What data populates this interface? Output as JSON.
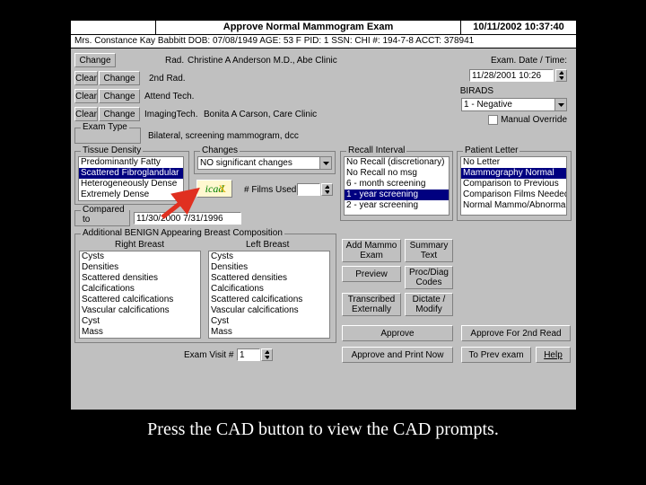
{
  "titlebar": {
    "left_blank": "",
    "title": "Approve Normal Mammogram Exam",
    "datetime": "10/11/2002 10:37:40"
  },
  "patient_line": "Mrs. Constance Kay Babbitt   DOB: 07/08/1949   AGE: 53   F   PID: 1   SSN:    CHI #: 194-7-8   ACCT: 378941",
  "buttons": {
    "change": "Change",
    "clear": "Clear",
    "add_mammo_exam": "Add Mammo Exam",
    "summary_text": "Summary Text",
    "preview": "Preview",
    "proc_diag": "Proc/Diag Codes",
    "transcribed": "Transcribed Externally",
    "dictate": "Dictate / Modify",
    "approve": "Approve",
    "approve_2nd": "Approve For 2nd Read",
    "approve_print": "Approve and Print Now",
    "to_prev": "To  Prev exam",
    "help": "Help",
    "icad": "icad"
  },
  "labels": {
    "rad": "Rad.",
    "rad_val": "Christine A Anderson M.D., Abe Clinic",
    "second_rad": "2nd Rad.",
    "attend_tech": "Attend Tech.",
    "imaging_tech": "ImagingTech.",
    "imaging_tech_val": "Bonita A Carson, Care Clinic",
    "exam_type": "Exam Type",
    "exam_type_val": "Bilateral, screening mammogram, dcc",
    "exam_datetime": "Exam. Date / Time:",
    "exam_datetime_val": "11/28/2001 10:26",
    "birads": "BIRADS",
    "birads_val": "1 - Negative",
    "manual_override": "Manual Override",
    "tissue_density": "Tissue Density",
    "changes_group": "Changes",
    "changes_val": "NO significant changes",
    "films_used": "# Films Used",
    "recall_interval": "Recall Interval",
    "patient_letter": "Patient Letter",
    "compared_to": "Compared to",
    "compared_val": "11/30/2000  7/31/1996",
    "benign_group": "Additional BENIGN Appearing Breast Composition",
    "right_breast": "Right Breast",
    "left_breast": "Left Breast",
    "exam_visit": "Exam Visit #",
    "exam_visit_val": "1"
  },
  "tissue_density": [
    "Predominantly Fatty",
    "Scattered Fibroglandular",
    "Heterogeneously Dense",
    "Extremely Dense"
  ],
  "tissue_density_selected": 1,
  "recall_interval": [
    "No Recall (discretionary)",
    "No Recall no msg",
    "6 - month screening",
    "1 - year screening",
    "2 - year screening"
  ],
  "recall_selected": 3,
  "patient_letter": [
    "No Letter",
    "Mammography Normal",
    "Comparison to Previous",
    "Comparison Films Needed",
    "Normal Mammo/Abnormal"
  ],
  "patient_letter_selected": 1,
  "right_breast_items": [
    "Cysts",
    "Densities",
    "Scattered densities",
    "Calcifications",
    "Scattered calcifications",
    "Vascular calcifications",
    "Cyst",
    "Mass"
  ],
  "left_breast_items": [
    "Cysts",
    "Densities",
    "Scattered densities",
    "Calcifications",
    "Scattered calcifications",
    "Vascular calcifications",
    "Cyst",
    "Mass"
  ],
  "caption": "Press the CAD button to view the CAD prompts."
}
